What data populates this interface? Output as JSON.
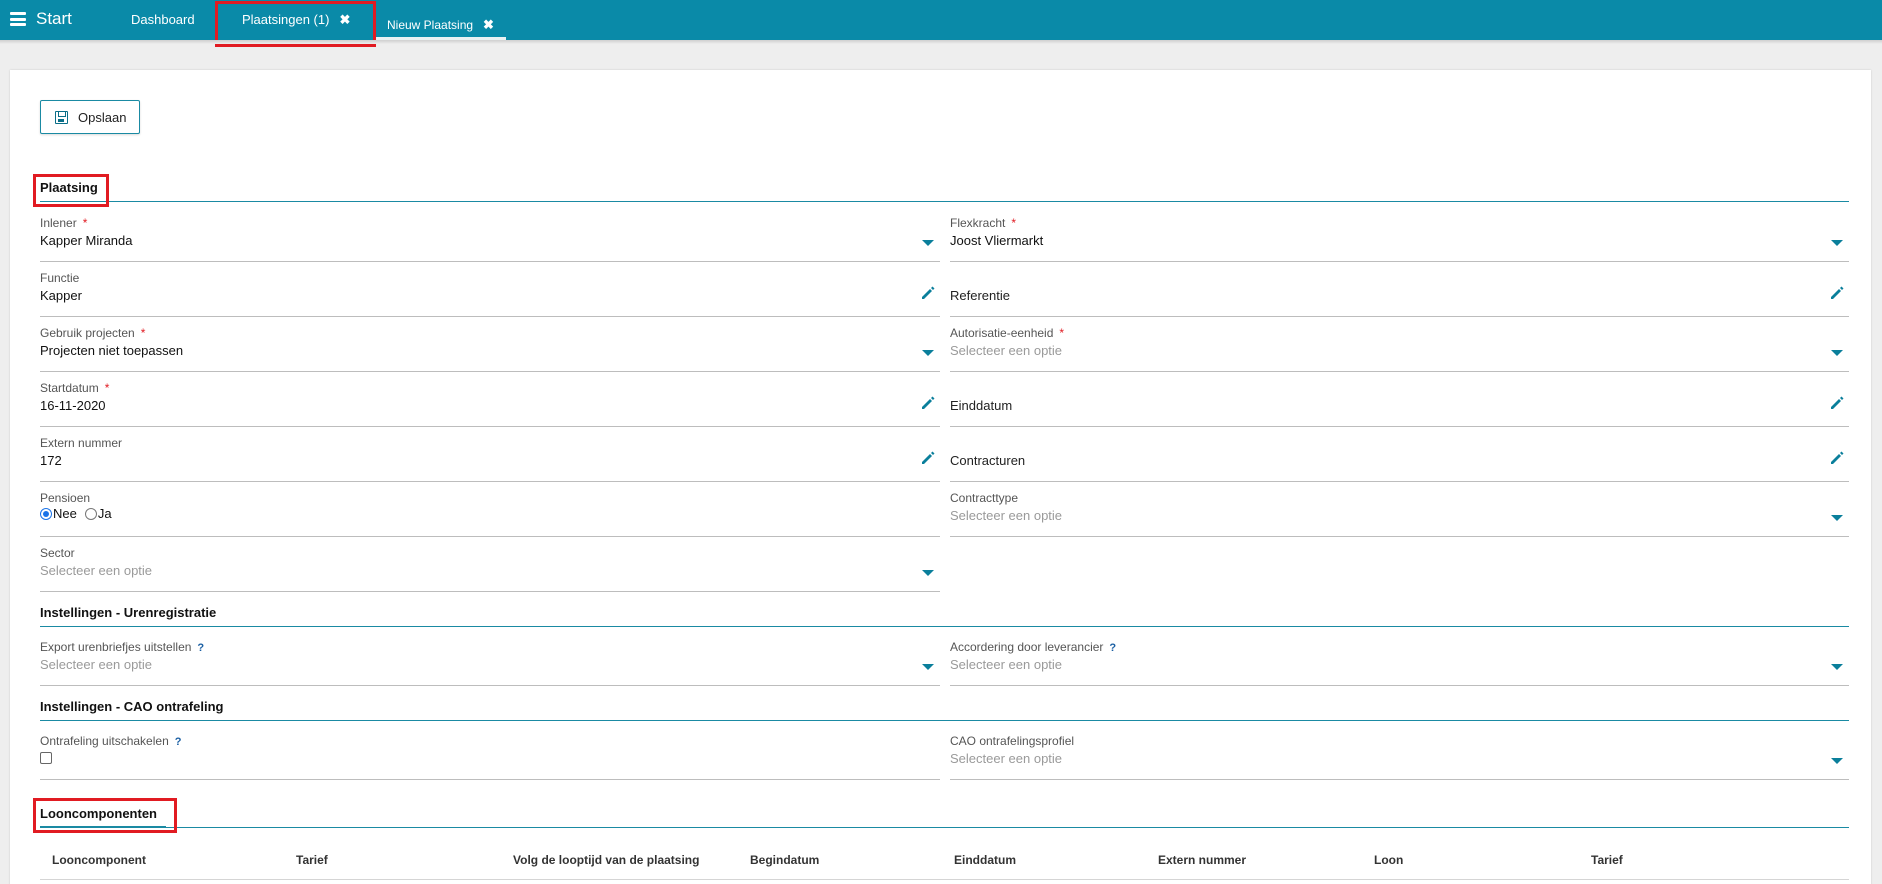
{
  "topbar": {
    "start_label": "Start",
    "tabs": [
      {
        "label": "Dashboard"
      },
      {
        "label": "Plaatsingen (1)",
        "close": "✖"
      },
      {
        "label": "Nieuw Plaatsing",
        "close": "✖"
      }
    ]
  },
  "toolbar": {
    "save_label": "Opslaan",
    "save_icon": "floppy-disk-icon"
  },
  "sections": {
    "plaatsing": "Plaatsing",
    "urenregistratie": "Instellingen - Urenregistratie",
    "cao": "Instellingen - CAO ontrafeling",
    "looncomponenten": "Looncomponenten"
  },
  "required_marker": "*",
  "help_marker": "?",
  "fields": {
    "inlener": {
      "label": "Inlener",
      "value": "Kapper Miranda"
    },
    "flexkracht": {
      "label": "Flexkracht",
      "value": "Joost Vliermarkt"
    },
    "functie": {
      "label": "Functie",
      "value": "Kapper"
    },
    "referentie": {
      "label": "Referentie"
    },
    "gebruik_projecten": {
      "label": "Gebruik projecten",
      "value": "Projecten niet toepassen"
    },
    "autorisatie": {
      "label": "Autorisatie-eenheid",
      "placeholder": "Selecteer een optie"
    },
    "startdatum": {
      "label": "Startdatum",
      "value": "16-11-2020"
    },
    "einddatum": {
      "label": "Einddatum"
    },
    "extern_nummer": {
      "label": "Extern nummer",
      "value": "172"
    },
    "contracturen": {
      "label": "Contracturen"
    },
    "pensioen": {
      "label": "Pensioen",
      "options": [
        "Nee",
        "Ja"
      ],
      "selected": "Nee"
    },
    "contracttype": {
      "label": "Contracttype",
      "placeholder": "Selecteer een optie"
    },
    "sector": {
      "label": "Sector",
      "placeholder": "Selecteer een optie"
    },
    "export_uren": {
      "label": "Export urenbriefjes uitstellen",
      "placeholder": "Selecteer een optie"
    },
    "accordering": {
      "label": "Accordering door leverancier",
      "placeholder": "Selecteer een optie"
    },
    "ontrafeling": {
      "label": "Ontrafeling uitschakelen",
      "checked": false
    },
    "cao_profiel": {
      "label": "CAO ontrafelingsprofiel",
      "placeholder": "Selecteer een optie"
    }
  },
  "looncomponenten_table": {
    "columns": [
      "Looncomponent",
      "Tarief",
      "Volg de looptijd van de plaatsing",
      "Begindatum",
      "Einddatum",
      "Extern nummer",
      "Loon",
      "Tarief"
    ]
  },
  "colors": {
    "topbar": "#0a8aa8",
    "accent": "#1a8aa3",
    "highlight": "#e11b22",
    "required": "#e11b22"
  }
}
